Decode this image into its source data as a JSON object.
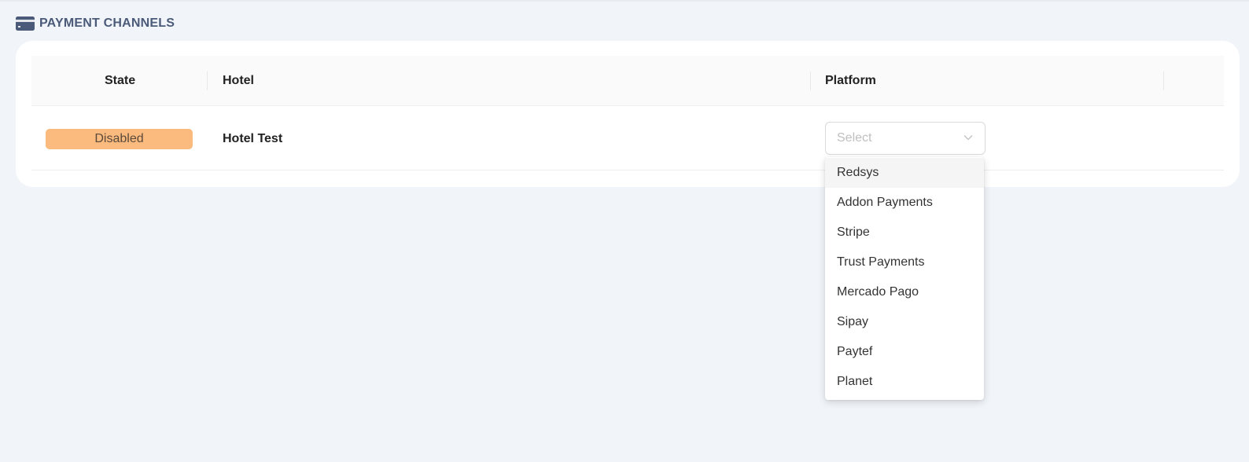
{
  "section": {
    "title": "PAYMENT CHANNELS",
    "icon": "credit-card-icon"
  },
  "table": {
    "columns": [
      "State",
      "Hotel",
      "Platform"
    ],
    "rows": [
      {
        "state": "Disabled",
        "hotel": "Hotel Test",
        "platform_placeholder": "Select"
      }
    ]
  },
  "dropdown": {
    "options": [
      "Redsys",
      "Addon Payments",
      "Stripe",
      "Trust Payments",
      "Mercado Pago",
      "Sipay",
      "Paytef",
      "Planet"
    ],
    "highlighted": "Redsys"
  },
  "colors": {
    "background": "#f1f5f9",
    "title": "#4a5a78",
    "disabled_badge": "#fbba7e"
  }
}
